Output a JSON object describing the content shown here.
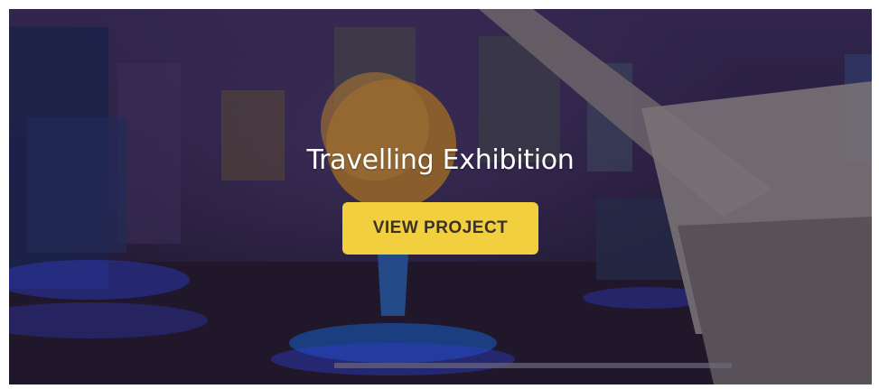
{
  "hero": {
    "title": "Travelling Exhibition",
    "cta_label": "VIEW PROJECT",
    "image_description": "Planetarium museum hall with a large globe on a blue pedestal and a telescope on the right"
  },
  "colors": {
    "cta_background": "#f2cf3f",
    "cta_text": "#3b3126",
    "title_text": "#ffffff",
    "overlay_tint": "#2a2140",
    "accent_glow": "#3a4cff"
  },
  "icons": {
    "globe": "globe-illustration",
    "telescope": "telescope-illustration"
  }
}
